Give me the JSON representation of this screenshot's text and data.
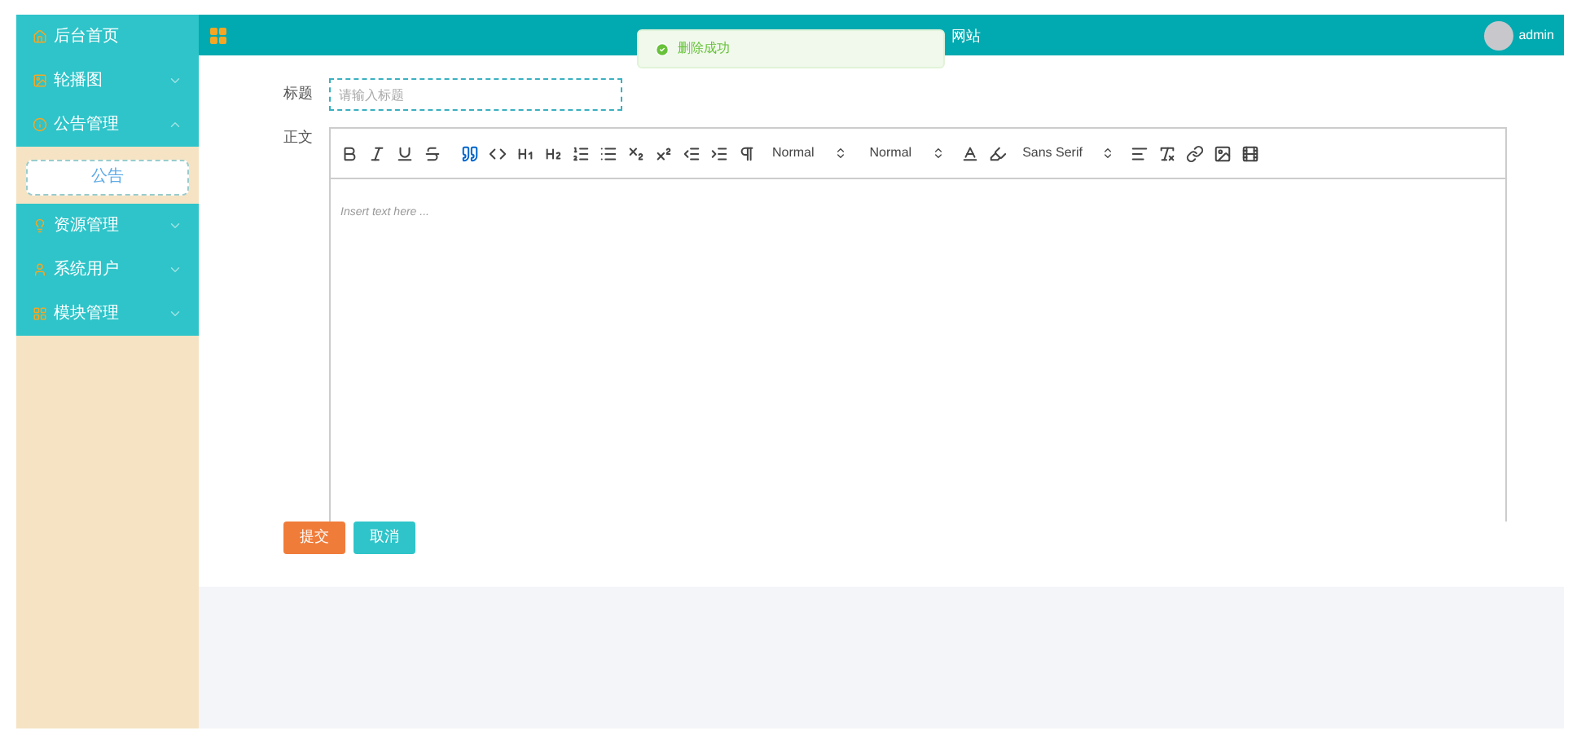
{
  "sidebar": {
    "items": [
      {
        "label": "后台首页",
        "kind": "home"
      },
      {
        "label": "轮播图",
        "kind": "image",
        "expanded": false
      },
      {
        "label": "公告管理",
        "kind": "info",
        "expanded": true,
        "children": [
          {
            "label": "公告",
            "selected": true
          }
        ]
      },
      {
        "label": "资源管理",
        "kind": "bulb",
        "expanded": false
      },
      {
        "label": "系统用户",
        "kind": "user",
        "expanded": false
      },
      {
        "label": "模块管理",
        "kind": "grid",
        "expanded": false
      }
    ]
  },
  "header": {
    "title": "网站",
    "user": "admin"
  },
  "toast": {
    "message": "删除成功"
  },
  "form": {
    "title_label": "标题",
    "title_placeholder": "请输入标题",
    "body_label": "正文",
    "editor": {
      "selects": [
        "Normal",
        "Normal",
        "Sans Serif"
      ],
      "placeholder": "Insert text here ..."
    },
    "buttons": [
      {
        "label": "提交",
        "kind": "primary"
      },
      {
        "label": "取消",
        "kind": "secondary"
      }
    ]
  }
}
